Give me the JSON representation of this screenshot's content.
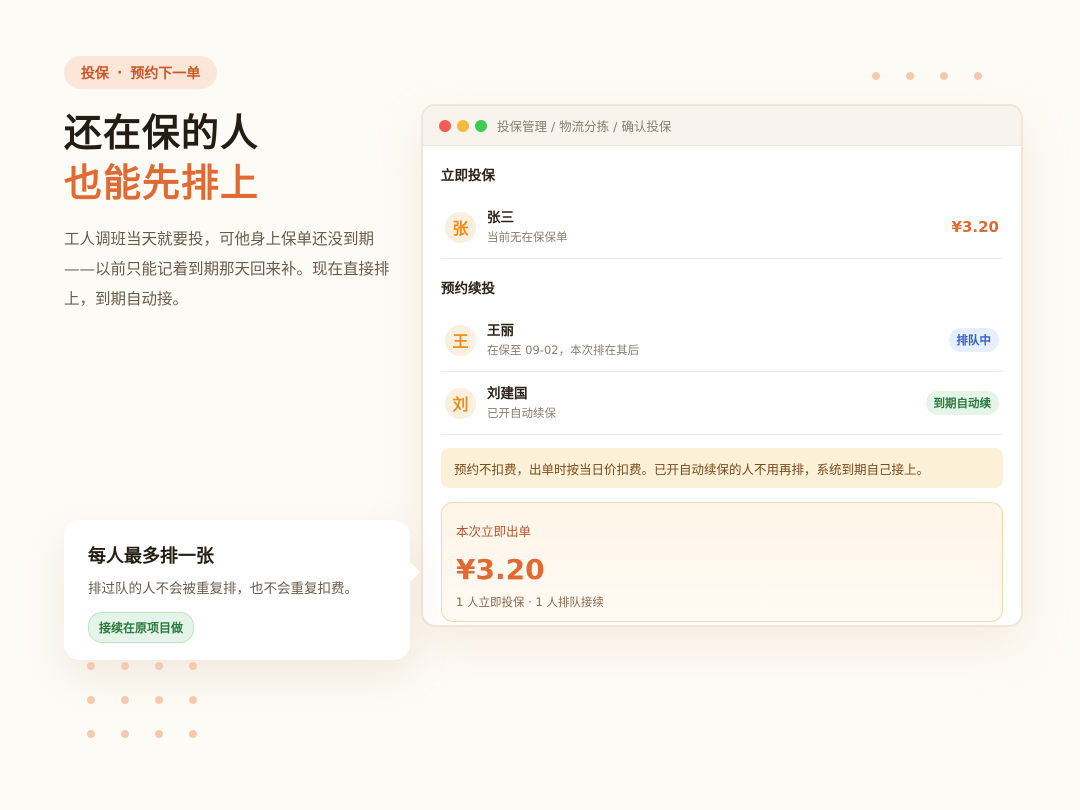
{
  "hero": {
    "tag_part1": "投保",
    "tag_sep": "·",
    "tag_part2": "预约下一单",
    "title_line1": "还在保的人",
    "title_line2": "也能先排上",
    "intro": "工人调班当天就要投，可他身上保单还没到期——以前只能记着到期那天回来补。现在直接排上，到期自动接。"
  },
  "window": {
    "breadcrumb": "投保管理 / 物流分拣 / 确认投保",
    "immediate": {
      "section_title": "立即投保",
      "rows": [
        {
          "avatar": "张",
          "name": "张三",
          "sub": "当前无在保保单",
          "price": "¥3.20"
        }
      ]
    },
    "reserve": {
      "section_title": "预约续投",
      "rows": [
        {
          "avatar": "王",
          "name": "王丽",
          "sub": "在保至 09-02，本次排在其后",
          "badge": "排队中"
        },
        {
          "avatar": "刘",
          "name": "刘建国",
          "sub": "已开自动续保",
          "badge": "到期自动续"
        }
      ]
    },
    "note": "预约不扣费，出单时按当日价扣费。已开自动续保的人不用再排，系统到期自己接上。",
    "summary": {
      "label": "本次立即出单",
      "amount": "¥3.20",
      "detail": "1 人立即投保 · 1 人排队接续"
    }
  },
  "callout": {
    "title": "每人最多排一张",
    "body": "排过队的人不会被重复排，也不会重复扣费。",
    "tag": "接续在原项目做"
  },
  "colors": {
    "accent": "#e06a32",
    "background": "#fdfbf6",
    "queue_badge": "#2f62c9",
    "renew_badge": "#2c7a3f"
  }
}
